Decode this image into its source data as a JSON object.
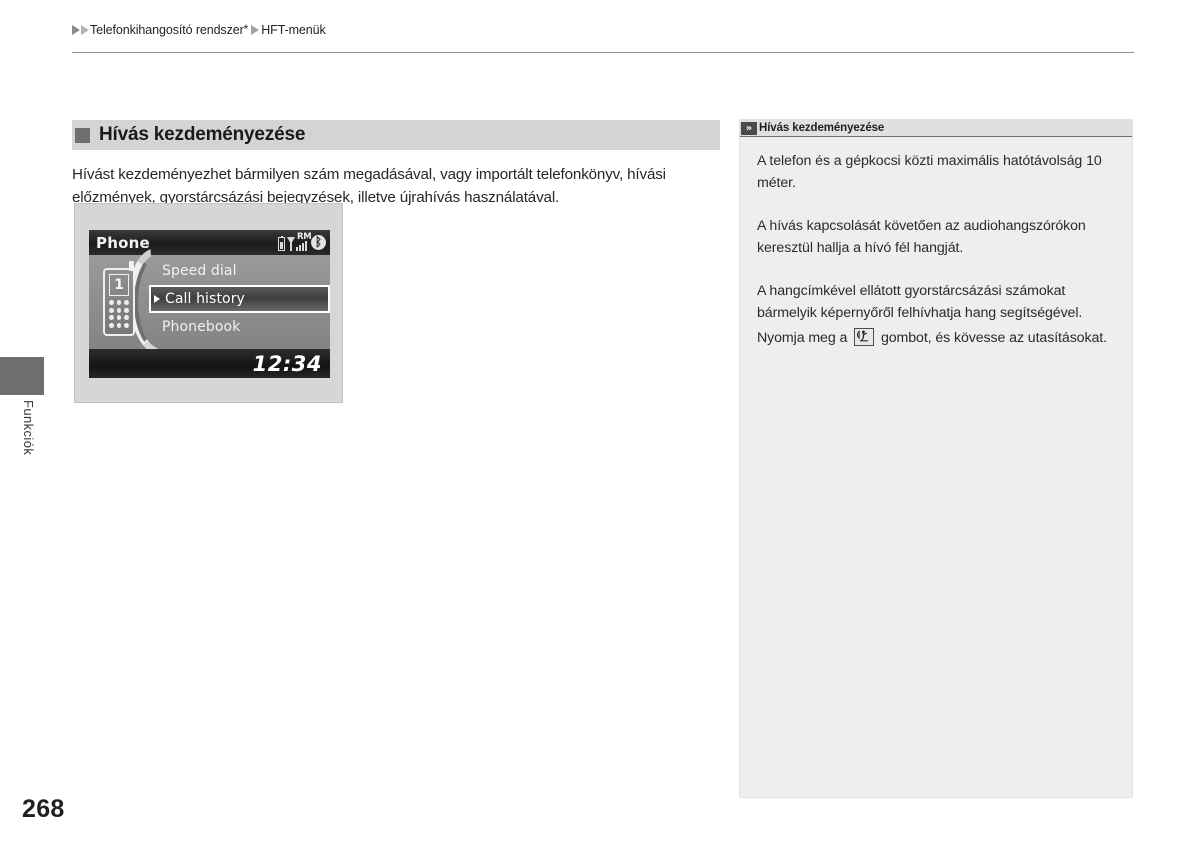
{
  "breadcrumb": {
    "items": [
      "Telefonkihangosító rendszer",
      "HFT-menük"
    ],
    "star": "*"
  },
  "side_tab": {
    "label": "Funkciók"
  },
  "page_number": "268",
  "main": {
    "heading": "Hívás kezdeményezése",
    "intro": "Hívást kezdeményezhet bármilyen szám megadásával, vagy importált telefonkönyv, hívási előzmények, gyorstárcsázási bejegyzések, illetve újrahívás használatával."
  },
  "device": {
    "title": "Phone",
    "status": {
      "roaming_label": "RM",
      "bluetooth_glyph": "ᛒ"
    },
    "phone_graphic_digit": "1",
    "menu_items": [
      {
        "label": "Speed dial",
        "selected": false
      },
      {
        "label": "Call history",
        "selected": true
      },
      {
        "label": "Phonebook",
        "selected": false
      }
    ],
    "clock": "12:34"
  },
  "info_panel": {
    "header_icon": "»",
    "header_title": "Hívás kezdeményezése",
    "paragraphs": [
      "A telefon és a gépkocsi közti maximális hatótávolság 10 méter.",
      "A hívás kapcsolását követően az audiohangszórókon keresztül hallja a hívó fél hangját.",
      "A hangcímkével ellátott gyorstárcsázási számokat bármelyik képernyőről felhívhatja hang segítségével."
    ],
    "last_line_before_icon": "Nyomja meg a",
    "last_line_after_icon": "gombot, és kövesse az utasításokat."
  },
  "colors": {
    "heading_band": "#d4d4d4",
    "heading_bullet": "#6f6f6f",
    "panel_bg": "#eeeeee",
    "side_tab": "#6e6e6e"
  }
}
